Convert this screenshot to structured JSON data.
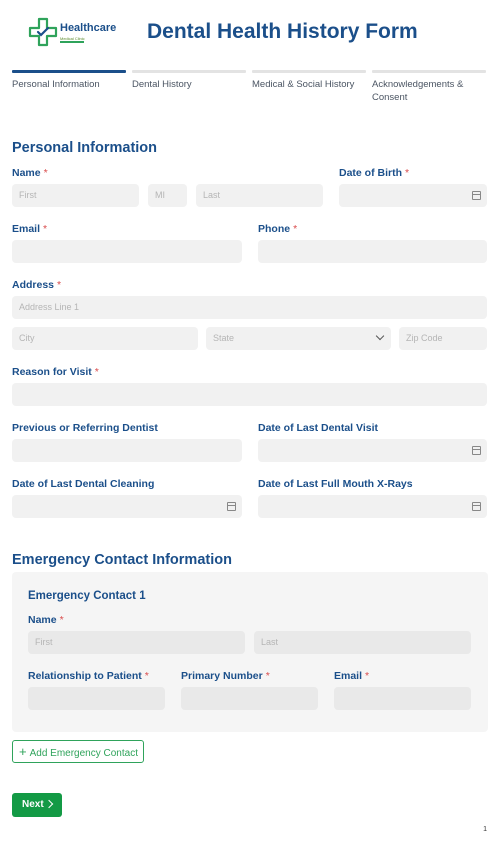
{
  "logo": {
    "word": "Healthcare",
    "sub": "Medical Clinic",
    "accent": "#2fa35b",
    "brand": "#1b4f8a"
  },
  "header": {
    "title": "Dental Health History Form"
  },
  "steps": [
    {
      "label": "Personal Information",
      "active": true
    },
    {
      "label": "Dental History",
      "active": false
    },
    {
      "label": "Medical & Social History",
      "active": false
    },
    {
      "label": "Acknowledgements & Consent",
      "active": false
    }
  ],
  "personal": {
    "title": "Personal Information",
    "name_label": "Name",
    "first_placeholder": "First",
    "mi_placeholder": "MI",
    "last_placeholder": "Last",
    "dob_label": "Date of Birth",
    "email_label": "Email",
    "phone_label": "Phone",
    "address_label": "Address",
    "address1_placeholder": "Address Line 1",
    "city_placeholder": "City",
    "state_placeholder": "State",
    "zip_placeholder": "Zip Code",
    "reason_label": "Reason for Visit",
    "prev_dentist_label": "Previous or Referring Dentist",
    "last_visit_label": "Date of Last Dental Visit",
    "last_cleaning_label": "Date of Last Dental Cleaning",
    "last_xray_label": "Date of Last Full Mouth X-Rays",
    "required_mark": "*"
  },
  "emergency": {
    "title": "Emergency Contact Information",
    "contact_title": "Emergency Contact 1",
    "name_label": "Name",
    "first_placeholder": "First",
    "last_placeholder": "Last",
    "relationship_label": "Relationship to Patient",
    "primary_label": "Primary Number",
    "email_label": "Email",
    "add_label": "Add Emergency Contact"
  },
  "footer": {
    "next_label": "Next",
    "page_number": "1"
  }
}
